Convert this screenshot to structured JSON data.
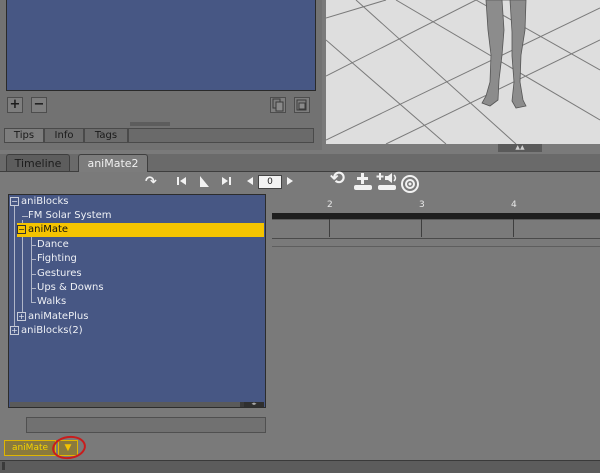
{
  "top_panel": {
    "add_label": "+",
    "remove_label": "−",
    "tabs": [
      {
        "label": "Tips"
      },
      {
        "label": "Info"
      },
      {
        "label": "Tags"
      }
    ]
  },
  "viewport": {
    "collapse_glyph": "▲▲"
  },
  "main_tabs": [
    {
      "label": "Timeline"
    },
    {
      "label": "aniMate2"
    }
  ],
  "transport": {
    "frame_value": "0",
    "icons": [
      "redo-icon",
      "go-to-start-icon",
      "play-icon",
      "go-to-end-icon",
      "step-back-icon",
      "step-forward-icon",
      "refresh-icon",
      "add-icon",
      "add-sound-icon",
      "target-icon"
    ]
  },
  "tree": {
    "items": [
      {
        "label": "aniBlocks"
      },
      {
        "label": "FM Solar System"
      },
      {
        "label": "aniMate"
      },
      {
        "label": "Dance"
      },
      {
        "label": "Fighting"
      },
      {
        "label": "Gestures"
      },
      {
        "label": "Ups & Downs"
      },
      {
        "label": "Walks"
      },
      {
        "label": "aniMatePlus"
      },
      {
        "label": "aniBlocks(2)"
      }
    ],
    "selected": "aniMate"
  },
  "timeline": {
    "ruler": [
      "2",
      "3",
      "4"
    ]
  },
  "bottom": {
    "dropdown_value": "aniMate",
    "dropdown_arrow": "▼"
  },
  "colors": {
    "selection": "#f5c400",
    "tree_bg": "#475784",
    "highlight": "#c91c1c"
  }
}
